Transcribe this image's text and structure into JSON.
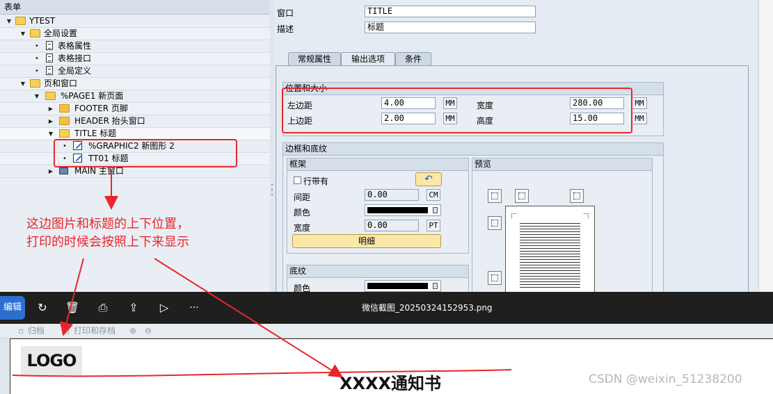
{
  "tree": {
    "header": "表单",
    "items": [
      {
        "label": "YTEST"
      },
      {
        "label": "全局设置"
      },
      {
        "label": "表格属性"
      },
      {
        "label": "表格接口"
      },
      {
        "label": "全局定义"
      },
      {
        "label": "页和窗口"
      },
      {
        "label": "%PAGE1 新页面"
      },
      {
        "label": "FOOTER 页脚"
      },
      {
        "label": "HEADER 抬头窗口"
      },
      {
        "label": "TITLE 标题"
      },
      {
        "label": "%GRAPHIC2 新图形 2"
      },
      {
        "label": "TT01 标题"
      },
      {
        "label": "MAIN 主窗口"
      }
    ]
  },
  "form": {
    "window_label": "窗口",
    "window_value": "TITLE",
    "desc_label": "描述",
    "desc_value": "标题"
  },
  "tabs": [
    {
      "label": "常规属性",
      "active": false
    },
    {
      "label": "输出选项",
      "active": true
    },
    {
      "label": "条件",
      "active": false
    }
  ],
  "position_group": {
    "title": "位置和大小",
    "left_margin_label": "左边距",
    "left_margin_value": "4.00",
    "left_margin_unit": "MM",
    "top_margin_label": "上边距",
    "top_margin_value": "2.00",
    "top_margin_unit": "MM",
    "width_label": "宽度",
    "width_value": "280.00",
    "width_unit": "MM",
    "height_label": "高度",
    "height_value": "15.00",
    "height_unit": "MM"
  },
  "border_group": {
    "title": "边框和底纹",
    "frame": {
      "title": "框架",
      "checkbox_label": "行带有",
      "spacing_label": "间距",
      "spacing_value": "0.00",
      "spacing_unit": "CM",
      "color_label": "颜色",
      "width_label": "宽度",
      "width_value": "0.00",
      "width_unit": "PT",
      "detail_button": "明细"
    },
    "preview_title": "预览",
    "shading": {
      "title": "底纹",
      "color_label": "颜色"
    }
  },
  "annotation": {
    "line1": "这边图片和标题的上下位置，",
    "line2": "打印的时候会按照上下来显示",
    "color": "#e8262b"
  },
  "viewer": {
    "edit_label": "编辑",
    "filename": "微信截图_20250324152953.png",
    "more_label": "···"
  },
  "document": {
    "toolbar_archive": "归档",
    "toolbar_print_archive": "打印和存档",
    "logo_text": "LOGO",
    "title_text": "XXXX通知书",
    "watermark": "CSDN @weixin_51238200"
  }
}
